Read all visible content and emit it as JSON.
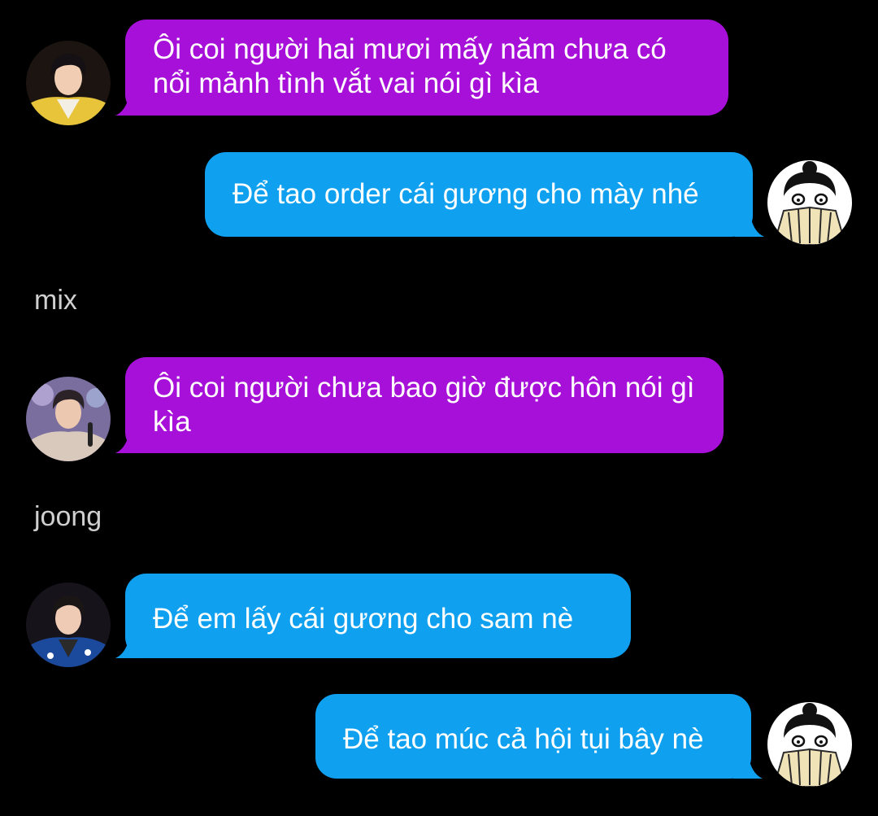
{
  "theme": {
    "background": "#000000",
    "purple_bubble": "#a710d8",
    "blue_bubble": "#0fa0f0",
    "sender_color": "#cfcfcf"
  },
  "messages": [
    {
      "side": "left",
      "color": "purple",
      "avatar": "male-idol-yellow-jacket-avatar",
      "text": "Ôi coi người hai mươi mấy năm chưa có nổi mảnh tình vắt vai nói gì kìa"
    },
    {
      "side": "right",
      "color": "blue",
      "avatar": "cartoon-girl-with-fan-avatar",
      "text": "Để tao order cái gương cho mày nhé"
    },
    {
      "sender": "mix"
    },
    {
      "side": "left",
      "color": "purple",
      "avatar": "male-idol-microphone-avatar",
      "text": "Ôi coi người chưa bao giờ được hôn nói gì kìa"
    },
    {
      "sender": "joong"
    },
    {
      "side": "left",
      "color": "blue",
      "avatar": "male-idol-blue-shirt-avatar",
      "text": "Để em lấy cái gương cho sam nè"
    },
    {
      "side": "right",
      "color": "blue",
      "avatar": "cartoon-girl-with-fan-avatar",
      "text": "Để tao múc cả hội tụi bây nè"
    }
  ]
}
